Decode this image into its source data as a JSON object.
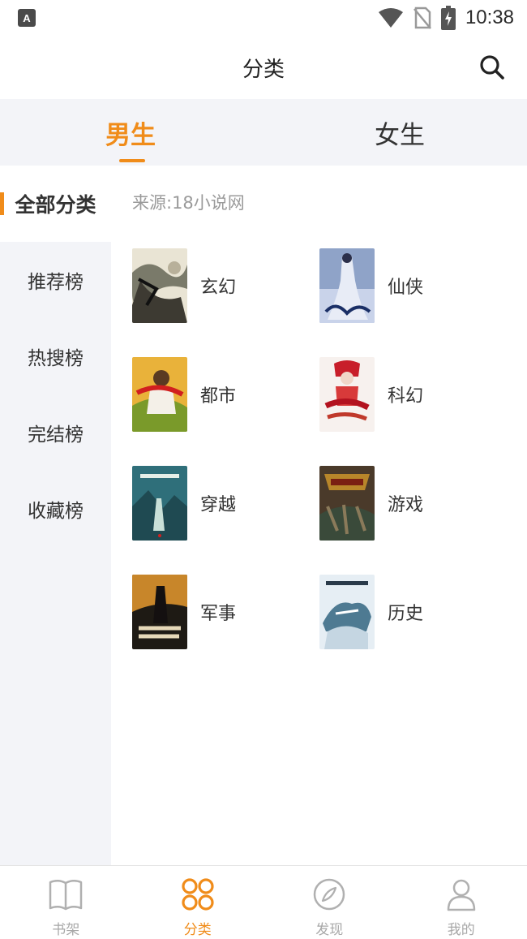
{
  "status_bar": {
    "app_icon_letter": "A",
    "time": "10:38"
  },
  "header": {
    "title": "分类"
  },
  "gender_tabs": [
    {
      "label": "男生",
      "active": true
    },
    {
      "label": "女生",
      "active": false
    }
  ],
  "sidebar": {
    "items": [
      {
        "label": "全部分类",
        "active": true
      },
      {
        "label": "推荐榜",
        "active": false
      },
      {
        "label": "热搜榜",
        "active": false
      },
      {
        "label": "完结榜",
        "active": false
      },
      {
        "label": "收藏榜",
        "active": false
      }
    ]
  },
  "content": {
    "source": "来源:18小说网",
    "categories": [
      {
        "label": "玄幻"
      },
      {
        "label": "仙侠"
      },
      {
        "label": "都市"
      },
      {
        "label": "科幻"
      },
      {
        "label": "穿越"
      },
      {
        "label": "游戏"
      },
      {
        "label": "军事"
      },
      {
        "label": "历史"
      }
    ]
  },
  "bottom_nav": {
    "items": [
      {
        "label": "书架",
        "icon": "book-icon",
        "active": false
      },
      {
        "label": "分类",
        "icon": "grid-icon",
        "active": true
      },
      {
        "label": "发现",
        "icon": "compass-icon",
        "active": false
      },
      {
        "label": "我的",
        "icon": "user-icon",
        "active": false
      }
    ]
  },
  "colors": {
    "accent": "#f08c1a",
    "panel_bg": "#f3f4f8",
    "muted_text": "#9a9a9a"
  }
}
